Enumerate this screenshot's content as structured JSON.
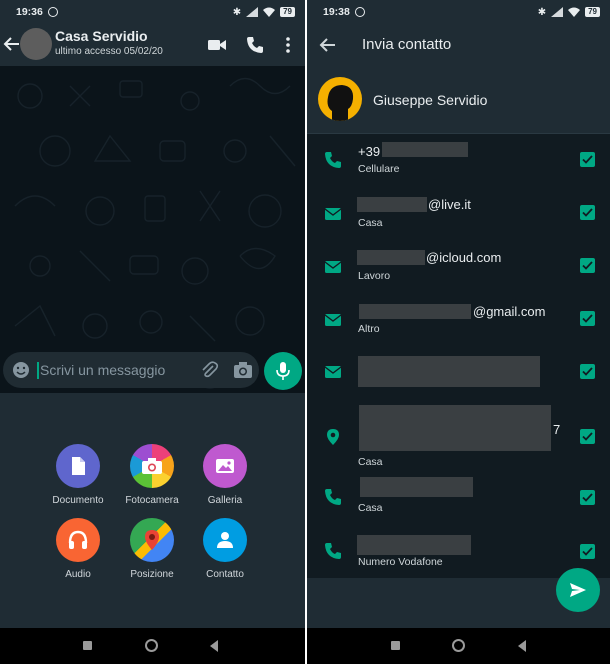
{
  "left": {
    "status": {
      "time": "19:36",
      "battery": "79"
    },
    "chat": {
      "title": "Casa Servidio",
      "subtitle": "ultimo accesso 05/02/20"
    },
    "composer": {
      "placeholder": "Scrivi un messaggio"
    },
    "attach": [
      {
        "label": "Documento",
        "color": "#5f66cd",
        "icon": "document-icon"
      },
      {
        "label": "Fotocamera",
        "color": "#ec407a",
        "icon": "camera-icon"
      },
      {
        "label": "Galleria",
        "color": "#bf59cf",
        "icon": "gallery-icon"
      },
      {
        "label": "Audio",
        "color": "#f96533",
        "icon": "headphones-icon"
      },
      {
        "label": "Posizione",
        "color": "#1fa855",
        "icon": "location-icon"
      },
      {
        "label": "Contatto",
        "color": "#009de2",
        "icon": "contact-icon"
      }
    ]
  },
  "right": {
    "status": {
      "time": "19:38",
      "battery": "79"
    },
    "title": "Invia contatto",
    "contact_name": "Giuseppe Servidio",
    "rows": [
      {
        "icon": "phone-icon",
        "value": "+39",
        "type": "Cellulare"
      },
      {
        "icon": "email-icon",
        "value": "@live.it",
        "type": "Casa"
      },
      {
        "icon": "email-icon",
        "value": "@icloud.com",
        "type": "Lavoro"
      },
      {
        "icon": "email-icon",
        "value": "@gmail.com",
        "type": "Altro"
      },
      {
        "icon": "email-icon",
        "value": "",
        "type": ""
      },
      {
        "icon": "location-pin-icon",
        "value": "7",
        "type": "Casa"
      },
      {
        "icon": "phone-icon",
        "value": "",
        "type": "Casa"
      },
      {
        "icon": "phone-icon",
        "value": "",
        "type": "Numero Vodafone"
      }
    ]
  },
  "colors": {
    "accent": "#00a884",
    "bar": "#1f2c34",
    "bg": "#111b21"
  }
}
